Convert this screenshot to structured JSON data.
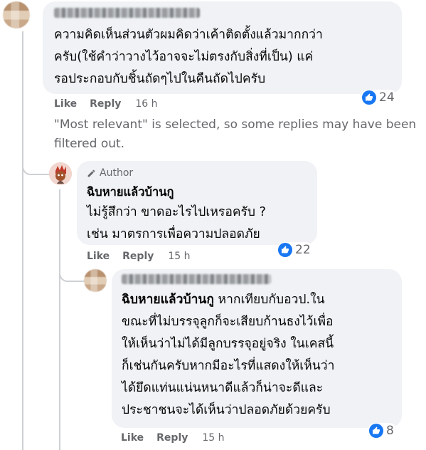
{
  "comment1": {
    "text": "ความคิดเห็นส่วนตัวผมคิดว่าเค้าติดตั้งแล้วมากกว่า\nครับ(ใช้คำว่าวางไว้อาจจะไม่ตรงกับสิ่งที่เป็น) แค่\nรอประกอบกับชิ้นถัดๆไปในคืนถัดไปครับ",
    "like_label": "Like",
    "reply_label": "Reply",
    "time": "16 h",
    "reaction_count": "24"
  },
  "filter_notice": "\"Most relevant\" is selected, so some replies may have been\nfiltered out.",
  "reply1": {
    "badge": "Author",
    "author": "ฉิบหายแล้วบ้านกู",
    "text": "ไม่รู้สึกว่า ขาดอะไรไปเหรอครับ ?\nเช่น มาตรการเพื่อความปลอดภัย",
    "like_label": "Like",
    "reply_label": "Reply",
    "time": "15 h",
    "reaction_count": "22"
  },
  "reply2": {
    "mention": "ฉิบหายแล้วบ้านกู",
    "text_first": " หากเทียบกับอวป.ใน",
    "text_rest": "ขณะที่ไม่บรรจุลูกก็จะเสียบก้านธงไว้เพื่อ\nให้เห็นว่าไม่ได้มีลูกบรรจุอยู่จริง ในเคสนี้\nก็เช่นกันครับหากมีอะไรที่แสดงให้เห็นว่า\nได้ยึดแท่นแน่นหนาดีแล้วก็น่าจะดีและ\nประชาชนจะได้เห็นว่าปลอดภัยด้วยครับ",
    "like_label": "Like",
    "reply_label": "Reply",
    "time": "15 h",
    "reaction_count": "8"
  },
  "colors": {
    "like_blue": "#1877f2",
    "bubble": "#f0f2f5",
    "meta_gray": "#65676b"
  }
}
